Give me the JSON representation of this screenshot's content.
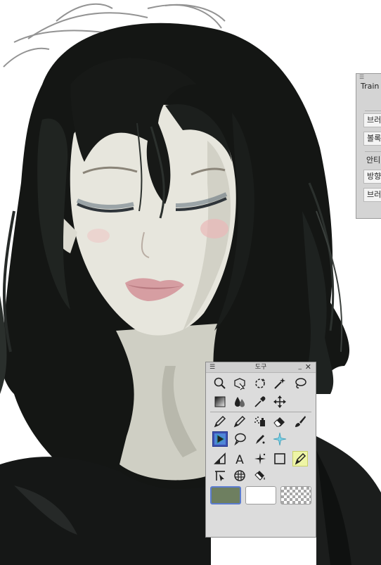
{
  "tool_palette": {
    "menu_icon": "menu-icon",
    "title": "도구",
    "minimize": "minimize-icon",
    "close": "close-icon",
    "rows": [
      [
        "zoom-icon",
        "object-selection-icon",
        "rotate-icon",
        "auto-select-wand-icon",
        "lasso-selection-icon"
      ],
      [
        "gradient-icon",
        "blend-drops-icon",
        "eyedropper-icon",
        "move-icon"
      ],
      [
        "pen-icon",
        "pencil-icon",
        "airbrush-icon",
        "eraser-icon",
        "brush-icon"
      ],
      [
        "fill-icon",
        "lasso-fill-icon",
        "decoration-pen-icon",
        "sparkle-icon"
      ],
      [
        "ruler-icon",
        "text-icon",
        "balloon-icon",
        "rectangle-icon",
        "marker-pen-icon"
      ],
      [
        "correct-line-icon",
        "frame-border-icon",
        "paint-bucket-icon"
      ]
    ],
    "colors": {
      "main_color": "#6e7f60",
      "sub_color": "#ffffff",
      "transparent": "transparent-swatch"
    },
    "active_tool": "fill-icon"
  },
  "sub_tool_panel": {
    "menu_icon": "menu-icon",
    "title": "Train",
    "items": [
      "브러",
      "볼록",
      "안티",
      "방향",
      "브러"
    ]
  }
}
